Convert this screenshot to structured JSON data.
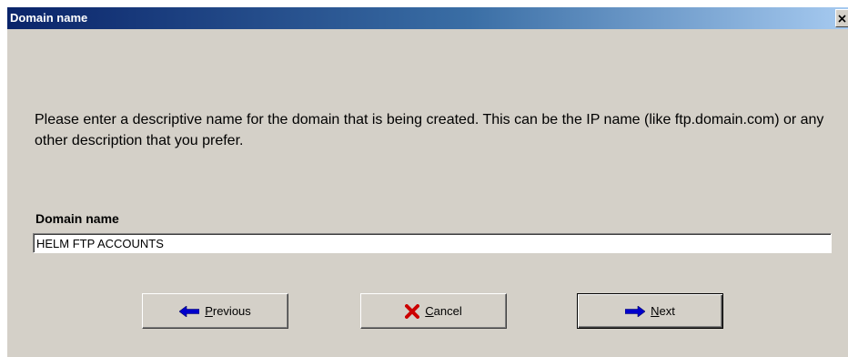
{
  "window": {
    "title": "Domain name",
    "close_glyph": "×"
  },
  "description": "Please enter a descriptive name for the domain that is being created. This can be the IP name (like ftp.domain.com) or any other description that you prefer.",
  "field": {
    "label": "Domain name",
    "value": "HELM FTP ACCOUNTS"
  },
  "buttons": {
    "previous": {
      "label_first": "P",
      "label_rest": "revious",
      "icon": "arrow-left-icon",
      "icon_color": "#0000cc"
    },
    "cancel": {
      "label_first": "C",
      "label_rest": "ancel",
      "icon": "x-icon",
      "icon_color": "#cc0000"
    },
    "next": {
      "label_first": "N",
      "label_rest": "ext",
      "icon": "arrow-right-icon",
      "icon_color": "#0000cc"
    }
  },
  "colors": {
    "titlebar_start": "#0a246a",
    "titlebar_end": "#a6caf0",
    "dialog_bg": "#d4d0c8"
  }
}
